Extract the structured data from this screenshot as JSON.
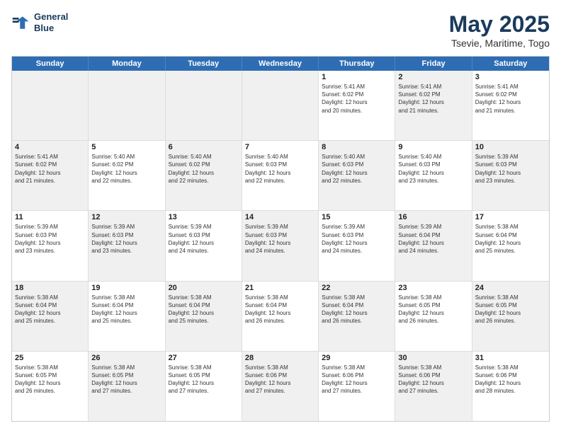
{
  "header": {
    "logo_line1": "General",
    "logo_line2": "Blue",
    "title": "May 2025",
    "subtitle": "Tsevie, Maritime, Togo"
  },
  "weekdays": [
    "Sunday",
    "Monday",
    "Tuesday",
    "Wednesday",
    "Thursday",
    "Friday",
    "Saturday"
  ],
  "rows": [
    [
      {
        "day": "",
        "info": "",
        "shaded": true
      },
      {
        "day": "",
        "info": "",
        "shaded": true
      },
      {
        "day": "",
        "info": "",
        "shaded": true
      },
      {
        "day": "",
        "info": "",
        "shaded": true
      },
      {
        "day": "1",
        "info": "Sunrise: 5:41 AM\nSunset: 6:02 PM\nDaylight: 12 hours\nand 20 minutes."
      },
      {
        "day": "2",
        "info": "Sunrise: 5:41 AM\nSunset: 6:02 PM\nDaylight: 12 hours\nand 21 minutes.",
        "shaded": true
      },
      {
        "day": "3",
        "info": "Sunrise: 5:41 AM\nSunset: 6:02 PM\nDaylight: 12 hours\nand 21 minutes."
      }
    ],
    [
      {
        "day": "4",
        "info": "Sunrise: 5:41 AM\nSunset: 6:02 PM\nDaylight: 12 hours\nand 21 minutes.",
        "shaded": true
      },
      {
        "day": "5",
        "info": "Sunrise: 5:40 AM\nSunset: 6:02 PM\nDaylight: 12 hours\nand 22 minutes."
      },
      {
        "day": "6",
        "info": "Sunrise: 5:40 AM\nSunset: 6:02 PM\nDaylight: 12 hours\nand 22 minutes.",
        "shaded": true
      },
      {
        "day": "7",
        "info": "Sunrise: 5:40 AM\nSunset: 6:03 PM\nDaylight: 12 hours\nand 22 minutes."
      },
      {
        "day": "8",
        "info": "Sunrise: 5:40 AM\nSunset: 6:03 PM\nDaylight: 12 hours\nand 22 minutes.",
        "shaded": true
      },
      {
        "day": "9",
        "info": "Sunrise: 5:40 AM\nSunset: 6:03 PM\nDaylight: 12 hours\nand 23 minutes."
      },
      {
        "day": "10",
        "info": "Sunrise: 5:39 AM\nSunset: 6:03 PM\nDaylight: 12 hours\nand 23 minutes.",
        "shaded": true
      }
    ],
    [
      {
        "day": "11",
        "info": "Sunrise: 5:39 AM\nSunset: 6:03 PM\nDaylight: 12 hours\nand 23 minutes."
      },
      {
        "day": "12",
        "info": "Sunrise: 5:39 AM\nSunset: 6:03 PM\nDaylight: 12 hours\nand 23 minutes.",
        "shaded": true
      },
      {
        "day": "13",
        "info": "Sunrise: 5:39 AM\nSunset: 6:03 PM\nDaylight: 12 hours\nand 24 minutes."
      },
      {
        "day": "14",
        "info": "Sunrise: 5:39 AM\nSunset: 6:03 PM\nDaylight: 12 hours\nand 24 minutes.",
        "shaded": true
      },
      {
        "day": "15",
        "info": "Sunrise: 5:39 AM\nSunset: 6:03 PM\nDaylight: 12 hours\nand 24 minutes."
      },
      {
        "day": "16",
        "info": "Sunrise: 5:39 AM\nSunset: 6:04 PM\nDaylight: 12 hours\nand 24 minutes.",
        "shaded": true
      },
      {
        "day": "17",
        "info": "Sunrise: 5:38 AM\nSunset: 6:04 PM\nDaylight: 12 hours\nand 25 minutes."
      }
    ],
    [
      {
        "day": "18",
        "info": "Sunrise: 5:38 AM\nSunset: 6:04 PM\nDaylight: 12 hours\nand 25 minutes.",
        "shaded": true
      },
      {
        "day": "19",
        "info": "Sunrise: 5:38 AM\nSunset: 6:04 PM\nDaylight: 12 hours\nand 25 minutes."
      },
      {
        "day": "20",
        "info": "Sunrise: 5:38 AM\nSunset: 6:04 PM\nDaylight: 12 hours\nand 25 minutes.",
        "shaded": true
      },
      {
        "day": "21",
        "info": "Sunrise: 5:38 AM\nSunset: 6:04 PM\nDaylight: 12 hours\nand 26 minutes."
      },
      {
        "day": "22",
        "info": "Sunrise: 5:38 AM\nSunset: 6:04 PM\nDaylight: 12 hours\nand 26 minutes.",
        "shaded": true
      },
      {
        "day": "23",
        "info": "Sunrise: 5:38 AM\nSunset: 6:05 PM\nDaylight: 12 hours\nand 26 minutes."
      },
      {
        "day": "24",
        "info": "Sunrise: 5:38 AM\nSunset: 6:05 PM\nDaylight: 12 hours\nand 26 minutes.",
        "shaded": true
      }
    ],
    [
      {
        "day": "25",
        "info": "Sunrise: 5:38 AM\nSunset: 6:05 PM\nDaylight: 12 hours\nand 26 minutes."
      },
      {
        "day": "26",
        "info": "Sunrise: 5:38 AM\nSunset: 6:05 PM\nDaylight: 12 hours\nand 27 minutes.",
        "shaded": true
      },
      {
        "day": "27",
        "info": "Sunrise: 5:38 AM\nSunset: 6:05 PM\nDaylight: 12 hours\nand 27 minutes."
      },
      {
        "day": "28",
        "info": "Sunrise: 5:38 AM\nSunset: 6:06 PM\nDaylight: 12 hours\nand 27 minutes.",
        "shaded": true
      },
      {
        "day": "29",
        "info": "Sunrise: 5:38 AM\nSunset: 6:06 PM\nDaylight: 12 hours\nand 27 minutes."
      },
      {
        "day": "30",
        "info": "Sunrise: 5:38 AM\nSunset: 6:06 PM\nDaylight: 12 hours\nand 27 minutes.",
        "shaded": true
      },
      {
        "day": "31",
        "info": "Sunrise: 5:38 AM\nSunset: 6:06 PM\nDaylight: 12 hours\nand 28 minutes."
      }
    ]
  ]
}
